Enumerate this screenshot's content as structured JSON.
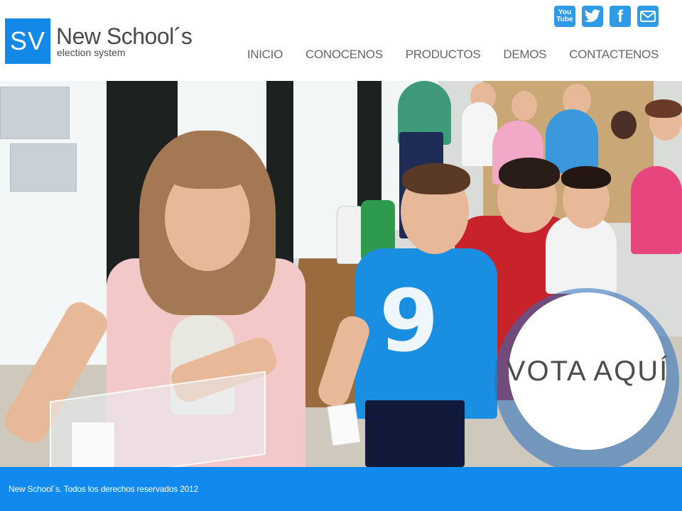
{
  "logo": {
    "initials": "SV",
    "name": "New School´s",
    "tagline": "election system"
  },
  "social": [
    {
      "name": "youtube",
      "label_top": "You",
      "label_bottom": "Tube",
      "icon": "youtube-icon"
    },
    {
      "name": "twitter",
      "icon": "twitter-bird-icon"
    },
    {
      "name": "facebook",
      "glyph": "f",
      "icon": "facebook-icon"
    },
    {
      "name": "email",
      "icon": "envelope-icon"
    }
  ],
  "nav": [
    "INICIO",
    "CONOCENOS",
    "PRODUCTOS",
    "DEMOS",
    "CONTACTENOS"
  ],
  "hero": {
    "shirt_number": "9",
    "cta": "VOTA AQUÍ"
  },
  "footer": {
    "copyright": "New School´s. Todos los derechos reservados 2012"
  },
  "colors": {
    "brand_blue": "#1488e6",
    "footer_blue": "#118af0",
    "social_blue": "#2f9be6",
    "nav_text": "#666666"
  }
}
